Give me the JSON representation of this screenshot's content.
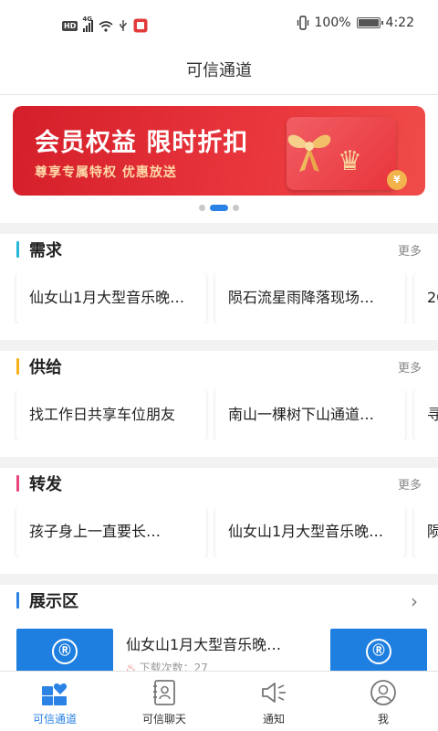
{
  "status_bar": {
    "hd": "HD",
    "network": "4G",
    "battery": "100%",
    "time": "4:22"
  },
  "header": {
    "title": "可信通道"
  },
  "banner": {
    "title": "会员权益 限时折扣",
    "subtitle": "尊享专属特权 优惠放送",
    "coin": "¥",
    "active_dot": 1,
    "dot_count": 3
  },
  "sections": {
    "demand": {
      "title": "需求",
      "more": "更多",
      "items": [
        "仙女山1月大型音乐晚…",
        "陨石流星雨降落现场…",
        "20"
      ]
    },
    "supply": {
      "title": "供给",
      "more": "更多",
      "items": [
        "找工作日共享车位朋友",
        "南山一棵树下山通道…",
        "寻"
      ]
    },
    "forward": {
      "title": "转发",
      "more": "更多",
      "items": [
        "孩子身上一直要长…",
        "仙女山1月大型音乐晚…",
        "陨"
      ]
    },
    "showcase": {
      "title": "展示区",
      "item_title": "仙女山1月大型音乐晚…",
      "item_meta": "下载次数：27"
    }
  },
  "bottom_nav": [
    {
      "label": "可信通道",
      "active": true
    },
    {
      "label": "可信聊天",
      "active": false
    },
    {
      "label": "通知",
      "active": false
    },
    {
      "label": "我",
      "active": false
    }
  ],
  "colors": {
    "accent": "#2a82e4",
    "demand_bar": "#29b6d8",
    "supply_bar": "#f5b21b",
    "forward_bar": "#e8467c",
    "showcase_bar": "#2a82e4"
  }
}
